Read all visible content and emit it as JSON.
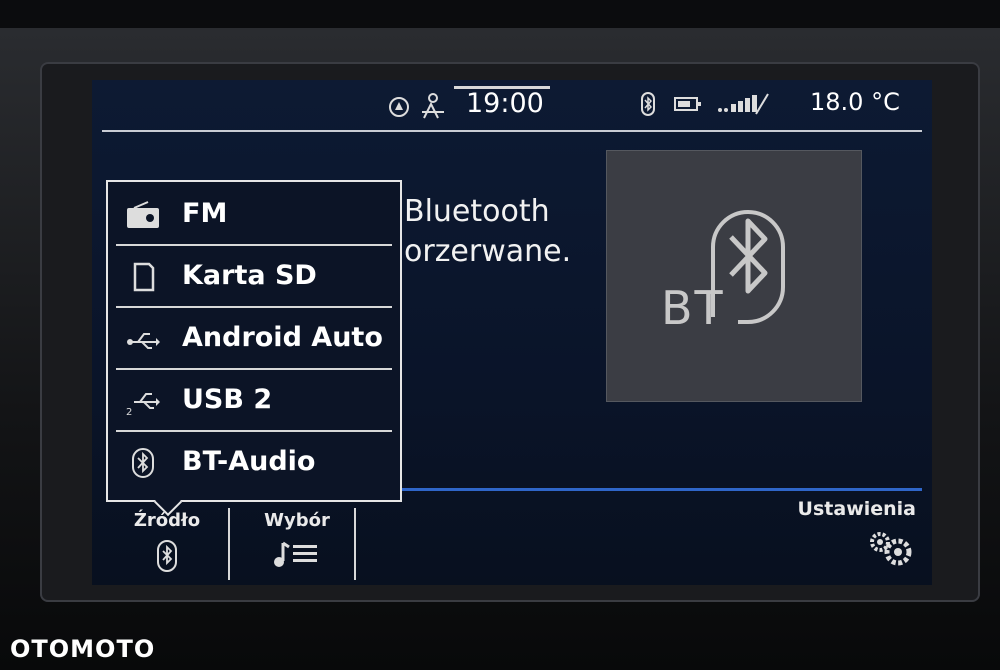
{
  "status": {
    "time": "19:00",
    "temperature": "18.0 °C",
    "signal_label": "..00ll"
  },
  "message": {
    "line1": "Bluetooth",
    "line2": "orzerwane."
  },
  "bt_tile": {
    "label": "BT"
  },
  "source_menu": {
    "items": [
      {
        "label": "FM",
        "icon": "radio-icon"
      },
      {
        "label": "Karta SD",
        "icon": "sd-card-icon"
      },
      {
        "label": "Android Auto",
        "icon": "usb-icon"
      },
      {
        "label": "USB 2",
        "icon": "usb-2-icon"
      },
      {
        "label": "BT-Audio",
        "icon": "bluetooth-icon"
      }
    ]
  },
  "bottom_bar": {
    "source_label": "Źródło",
    "selection_label": "Wybór",
    "settings_label": "Ustawienia"
  },
  "watermark": "OTOMOTO",
  "colors": {
    "screen_bg": "#0a1429",
    "accent_blue": "#2f66c9",
    "text": "#ffffff"
  }
}
